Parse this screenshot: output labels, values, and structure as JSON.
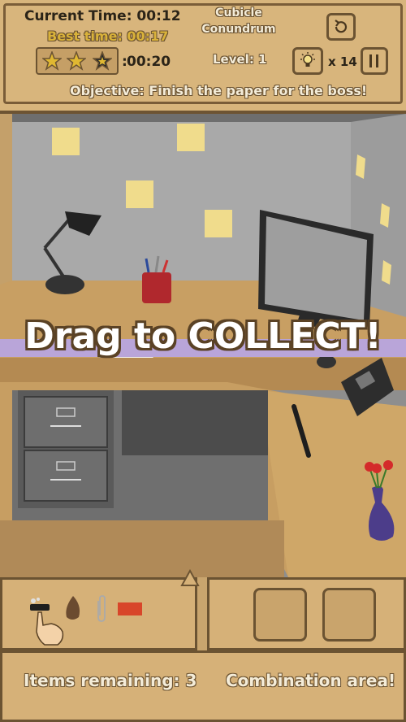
{
  "hud": {
    "current_time_label": "Current Time: 00:12",
    "best_time_label": "Best time: 00:17",
    "star_time": "00:20",
    "stars_earned": 2,
    "stars_total": 3,
    "title_line1": "Cubicle",
    "title_line2": "Conundrum",
    "level_label": "Level: 1",
    "hint_count": "x 14",
    "objective": "Objective: Finish the paper for the boss!"
  },
  "scene": {
    "tutorial_text": "Drag to COLLECT!"
  },
  "inventory": {
    "items": [
      "lighter",
      "stone",
      "paper-clip",
      "matchbook"
    ]
  },
  "footer": {
    "items_remaining": "Items remaining: 3",
    "combination_area": "Combination area!"
  },
  "colors": {
    "hud_bg": "#d8b57c",
    "border": "#6b5332",
    "banner": "#b9a5d9",
    "star": "#e0b832"
  }
}
